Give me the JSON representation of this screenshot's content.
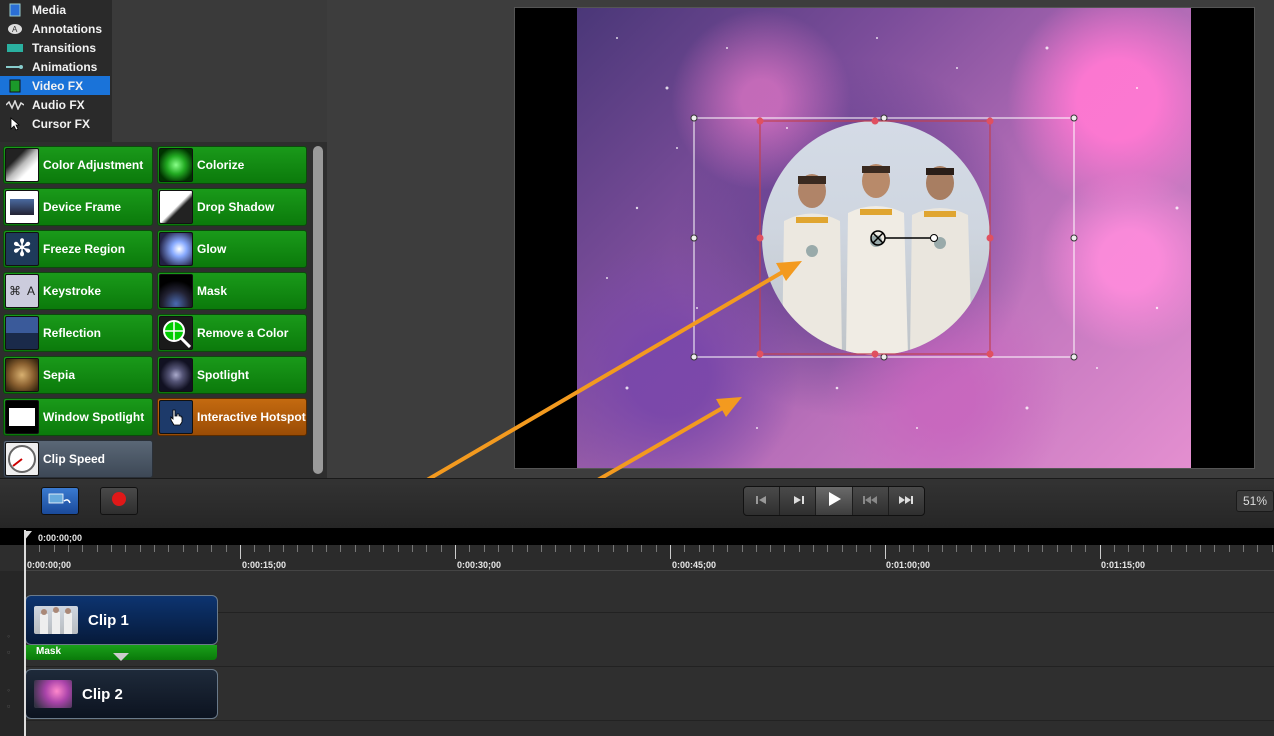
{
  "categories": [
    {
      "label": "Media",
      "icon": "media-icon"
    },
    {
      "label": "Annotations",
      "icon": "annotations-icon"
    },
    {
      "label": "Transitions",
      "icon": "transitions-icon"
    },
    {
      "label": "Animations",
      "icon": "animations-icon"
    },
    {
      "label": "Video FX",
      "icon": "video-fx-icon",
      "selected": true
    },
    {
      "label": "Audio FX",
      "icon": "audio-fx-icon"
    },
    {
      "label": "Cursor FX",
      "icon": "cursor-fx-icon"
    }
  ],
  "effects": [
    {
      "label": "Color Adjustment",
      "icon": "color-adjustment-icon"
    },
    {
      "label": "Colorize",
      "icon": "colorize-icon"
    },
    {
      "label": "Device Frame",
      "icon": "device-frame-icon"
    },
    {
      "label": "Drop Shadow",
      "icon": "drop-shadow-icon"
    },
    {
      "label": "Freeze Region",
      "icon": "snowflake-icon"
    },
    {
      "label": "Glow",
      "icon": "glow-icon"
    },
    {
      "label": "Keystroke",
      "icon": "keystroke-icon"
    },
    {
      "label": "Mask",
      "icon": "mask-icon"
    },
    {
      "label": "Reflection",
      "icon": "reflection-icon"
    },
    {
      "label": "Remove a Color",
      "icon": "remove-color-icon"
    },
    {
      "label": "Sepia",
      "icon": "sepia-icon"
    },
    {
      "label": "Spotlight",
      "icon": "spotlight-icon"
    },
    {
      "label": "Window Spotlight",
      "icon": "window-spotlight-icon"
    },
    {
      "label": "Interactive Hotspot",
      "icon": "hotspot-icon"
    },
    {
      "label": "Clip Speed",
      "icon": "clip-speed-icon"
    }
  ],
  "transport": {
    "zoom": "51%"
  },
  "timeline": {
    "playhead_time": "0:00:00;00",
    "ruler_labels": [
      "0:00:00;00",
      "0:00:15;00",
      "0:00:30;00",
      "0:00:45;00",
      "0:01:00;00",
      "0:01:15;00"
    ]
  },
  "clips": {
    "clip1": {
      "label": "Clip 1",
      "effect": "Mask"
    },
    "clip2": {
      "label": "Clip 2"
    }
  },
  "colors": {
    "accent_orange": "#f39a1f",
    "effect_green": "#0f8a0f",
    "selection_blue": "#1a73d9"
  }
}
